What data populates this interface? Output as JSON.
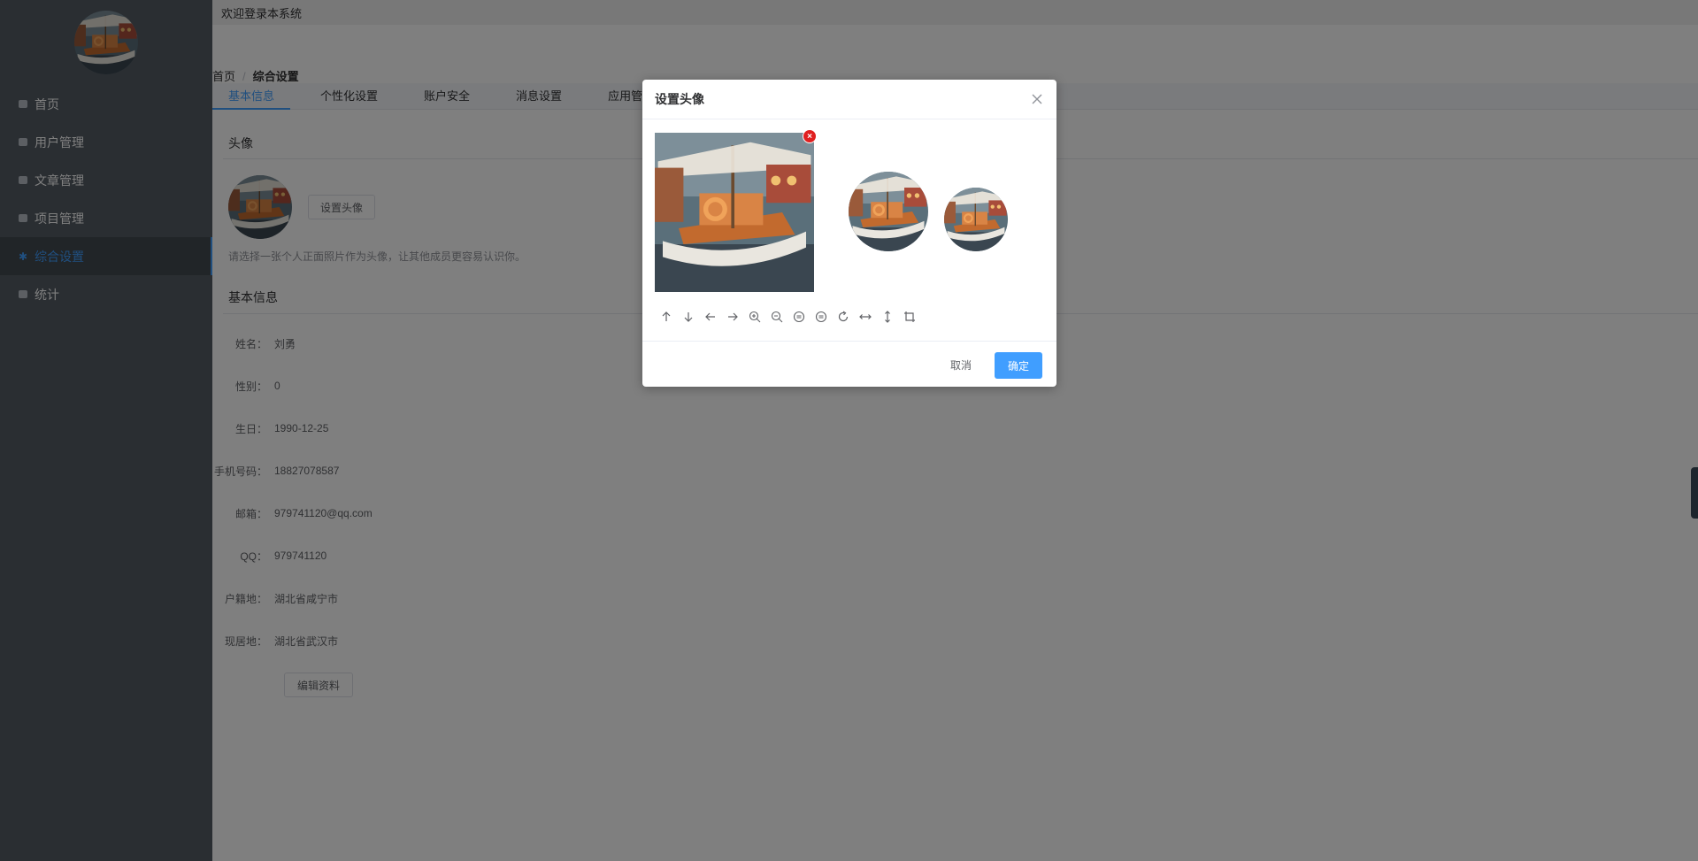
{
  "topbar": {
    "welcome": "欢迎登录本系统"
  },
  "sidebar": {
    "items": [
      {
        "label": "首页",
        "icon": "square-icon"
      },
      {
        "label": "用户管理",
        "icon": "grid-icon"
      },
      {
        "label": "文章管理",
        "icon": "grid-icon"
      },
      {
        "label": "项目管理",
        "icon": "grid-icon"
      },
      {
        "label": "综合设置",
        "icon": "settings-icon",
        "active": true
      },
      {
        "label": "统计",
        "icon": "grid-icon"
      }
    ]
  },
  "breadcrumb": {
    "home": "首页",
    "separator": "/",
    "current": "综合设置"
  },
  "tabs": [
    "基本信息",
    "个性化设置",
    "账户安全",
    "消息设置",
    "应用管理"
  ],
  "profile": {
    "avatar_title": "头像",
    "set_avatar_button": "设置头像",
    "tip": "请选择一张个人正面照片作为头像，让其他成员更容易认识你。",
    "info_title": "基本信息",
    "fields": [
      {
        "label": "姓名：",
        "value": "刘勇"
      },
      {
        "label": "性别：",
        "value": "0"
      },
      {
        "label": "生日：",
        "value": "1990-12-25"
      },
      {
        "label": "手机号码：",
        "value": "18827078587"
      },
      {
        "label": "邮箱：",
        "value": "979741120@qq.com"
      },
      {
        "label": "QQ：",
        "value": "979741120"
      },
      {
        "label": "户籍地：",
        "value": "湖北省咸宁市"
      },
      {
        "label": "现居地：",
        "value": "湖北省武汉市"
      }
    ],
    "edit_button": "编辑资料"
  },
  "dialog": {
    "title": "设置头像",
    "remove_badge": "×",
    "cancel_button": "取消",
    "ok_button": "确定",
    "tools": [
      "arrow-up-icon",
      "arrow-down-icon",
      "arrow-left-icon",
      "arrow-right-icon",
      "zoom-in-icon",
      "zoom-out-icon",
      "rotate-left-90-icon",
      "rotate-right-90-icon",
      "rotate-icon",
      "flip-horizontal-icon",
      "flip-vertical-icon",
      "crop-icon"
    ]
  },
  "colors": {
    "primary": "#409eff",
    "sidebar": "#545c64",
    "danger": "#e02020"
  }
}
